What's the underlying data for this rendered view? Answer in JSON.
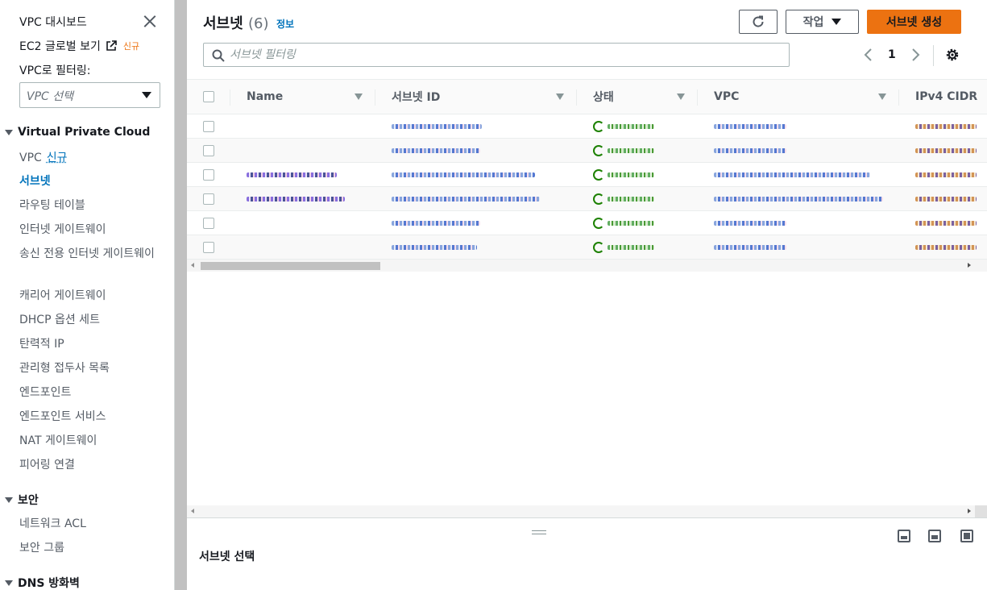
{
  "sidebar": {
    "header": "VPC 대시보드",
    "ec2_global": "EC2 글로벌 보기",
    "new_badge": "신규",
    "filter_label": "VPC로 필터링:",
    "select_placeholder": "VPC 선택",
    "section_vpc": "Virtual Private Cloud",
    "vpc_item": "VPC",
    "vpc_new": "신규",
    "items": [
      "서브넷",
      "라우팅 테이블",
      "인터넷 게이트웨이",
      "송신 전용 인터넷 게이트웨이",
      "캐리어 게이트웨이",
      "DHCP 옵션 세트",
      "탄력적 IP",
      "관리형 접두사 목록",
      "엔드포인트",
      "엔드포인트 서비스",
      "NAT 게이트웨이",
      "피어링 연결"
    ],
    "section_security": "보안",
    "security_items": [
      "네트워크 ACL",
      "보안 그룹"
    ],
    "section_dns": "DNS 방화벽"
  },
  "main": {
    "title": "서브넷",
    "count": "(6)",
    "info": "정보",
    "actions_label": "작업",
    "create_label": "서브넷 생성",
    "search_placeholder": "서브넷 필터링",
    "page": "1",
    "columns": [
      "Name",
      "서브넷 ID",
      "상태",
      "VPC",
      "IPv4 CIDR"
    ],
    "split_title": "서브넷 선택"
  },
  "colors": {
    "accent": "#ec7211",
    "link": "#0073bb",
    "available": "#1d8102"
  }
}
